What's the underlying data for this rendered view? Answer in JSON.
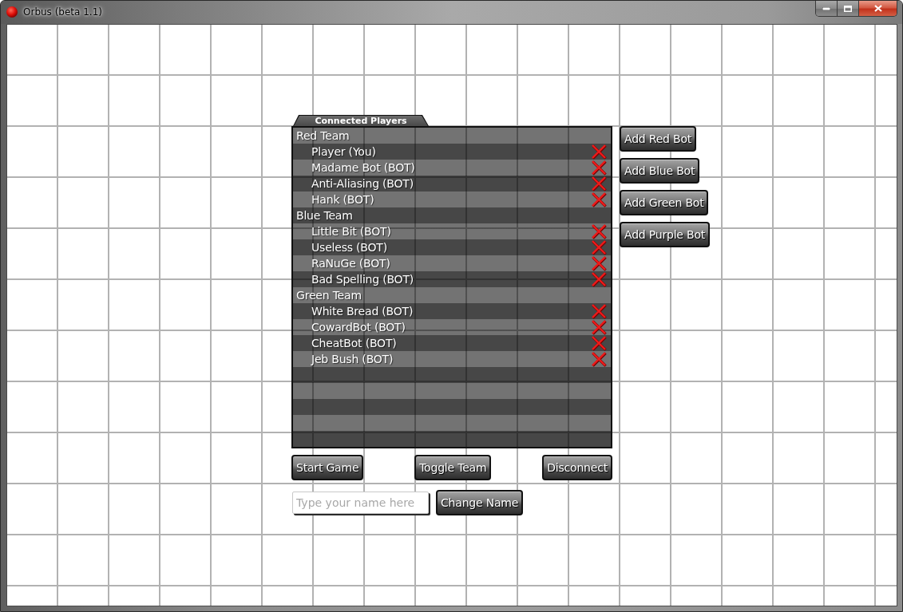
{
  "window": {
    "title": "Orbus (beta 1.1)"
  },
  "players_panel": {
    "tab": "Connected Players",
    "teams": [
      {
        "name": "Red Team",
        "children": [
          {
            "name": "Player (You)"
          },
          {
            "name": "Madame Bot (BOT)"
          },
          {
            "name": "Anti-Aliasing (BOT)"
          },
          {
            "name": "Hank (BOT)"
          }
        ]
      },
      {
        "name": "Blue Team",
        "children": [
          {
            "name": "Little Bit (BOT)"
          },
          {
            "name": "Useless (BOT)"
          },
          {
            "name": "RaNuGe (BOT)"
          },
          {
            "name": "Bad Spelling (BOT)"
          }
        ]
      },
      {
        "name": "Green Team",
        "children": [
          {
            "name": "White Bread (BOT)"
          },
          {
            "name": "CowardBot (BOT)"
          },
          {
            "name": "CheatBot (BOT)"
          },
          {
            "name": "Jeb Bush (BOT)"
          }
        ]
      }
    ]
  },
  "bot_buttons": [
    {
      "label": "Add Red Bot"
    },
    {
      "label": "Add Blue Bot"
    },
    {
      "label": "Add Green Bot"
    },
    {
      "label": "Add Purple Bot"
    }
  ],
  "action_buttons": [
    {
      "label": "Start Game"
    },
    {
      "label": "Toggle Team"
    },
    {
      "label": "Disconnect"
    }
  ],
  "name_field": {
    "placeholder": "Type your name here"
  },
  "change_name_button": {
    "label": "Change Name"
  }
}
